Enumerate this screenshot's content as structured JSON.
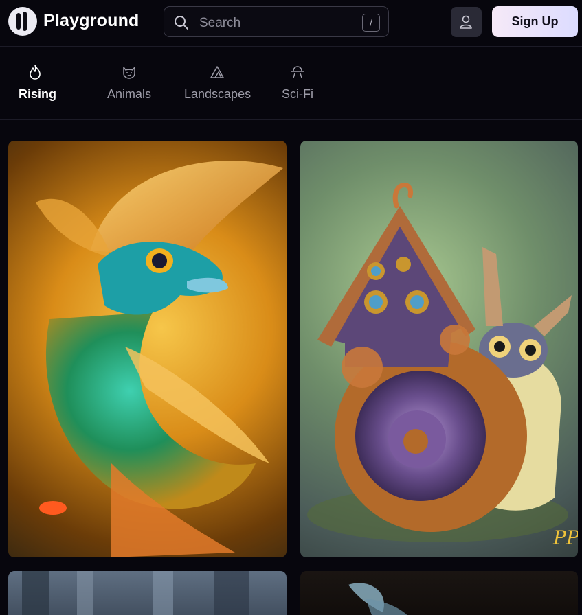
{
  "header": {
    "brand": "Playground",
    "search_placeholder": "Search",
    "search_shortcut": "/",
    "signup_label": "Sign Up"
  },
  "categories": [
    {
      "label": "Rising",
      "icon": "flame-icon",
      "active": true
    },
    {
      "label": "Animals",
      "icon": "cat-icon",
      "active": false
    },
    {
      "label": "Landscapes",
      "icon": "mountain-icon",
      "active": false
    },
    {
      "label": "Sci-Fi",
      "icon": "ufo-icon",
      "active": false
    }
  ],
  "gallery": [
    {
      "subject": "ornate golden fish with peacock feathers"
    },
    {
      "subject": "snail carrying a little house on its shell"
    },
    {
      "subject": "misty forest"
    },
    {
      "subject": "dragonfly wings on dark background"
    }
  ]
}
